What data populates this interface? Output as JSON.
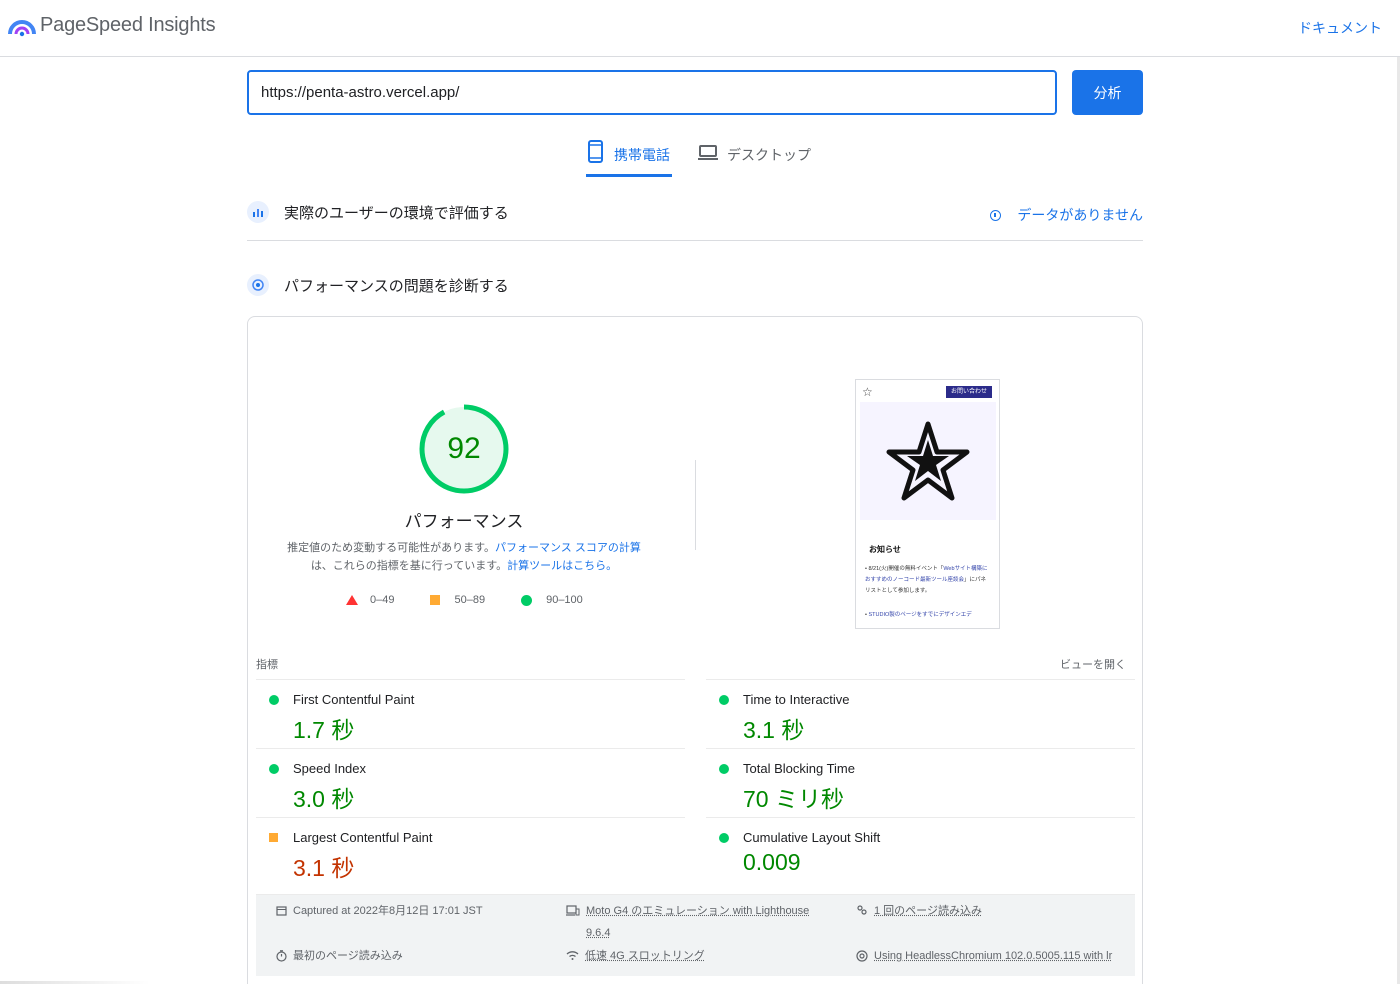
{
  "header": {
    "app_name": "PageSpeed Insights",
    "docs_link": "ドキュメント"
  },
  "search": {
    "url_value": "https://penta-astro.vercel.app/",
    "analyze_label": "分析"
  },
  "tabs": [
    {
      "label": "携帯電話",
      "active": true,
      "icon": "smartphone-icon"
    },
    {
      "label": "デスクトップ",
      "active": false,
      "icon": "laptop-icon"
    }
  ],
  "field_data": {
    "title": "実際のユーザーの環境で評価する",
    "no_data": "データがありません"
  },
  "lab_data": {
    "title": "パフォーマンスの問題を診断する"
  },
  "score": {
    "value": 92,
    "fraction": 0.92,
    "label": "パフォーマンス",
    "note_1": "推定値のため変動する可能性があります。",
    "note_link_1": "パフォーマンス スコアの計算",
    "note_2": "は、これらの指標を基に行っています。",
    "note_link_2": "計算ツールはこちら。",
    "color": "#00cc66"
  },
  "legend": [
    {
      "range": "0–49",
      "shape": "triangle",
      "color": "#ff3333"
    },
    {
      "range": "50–89",
      "shape": "square",
      "color": "#ffaa33"
    },
    {
      "range": "90–100",
      "shape": "circle",
      "color": "#00cc66"
    }
  ],
  "thumbnail": {
    "contact": "お問い合わせ",
    "news": "お知らせ",
    "item_1_a": "8/21(火)開催の無料イベント「",
    "item_1_b": "Webサイト構築におすすめのノーコード最新ツール座談会",
    "item_1_c": "」にパネリストとして参加します。",
    "item_2": "STUDIO製のページをすでにデザインエデ"
  },
  "metrics_section": {
    "label": "指標",
    "expand": "ビューを開く"
  },
  "metrics": [
    {
      "name": "First Contentful Paint",
      "value": "1.7 秒",
      "status": "good"
    },
    {
      "name": "Time to Interactive",
      "value": "3.1 秒",
      "status": "good"
    },
    {
      "name": "Speed Index",
      "value": "3.0 秒",
      "status": "good"
    },
    {
      "name": "Total Blocking Time",
      "value": "70 ミリ秒",
      "status": "good"
    },
    {
      "name": "Largest Contentful Paint",
      "value": "3.1 秒",
      "status": "average"
    },
    {
      "name": "Cumulative Layout Shift",
      "value": "0.009",
      "status": "good"
    }
  ],
  "run_info": {
    "captured": "Captured at 2022年8月12日 17:01 JST",
    "device": "Moto G4 のエミュレーション with Lighthouse",
    "device_version": "9.6.4",
    "page_loads": "1 回のページ読み込み",
    "initial_load": "最初のページ読み込み",
    "throttling": "低速 4G スロットリング",
    "browser": "Using HeadlessChromium 102.0.5005.115 with lr"
  }
}
